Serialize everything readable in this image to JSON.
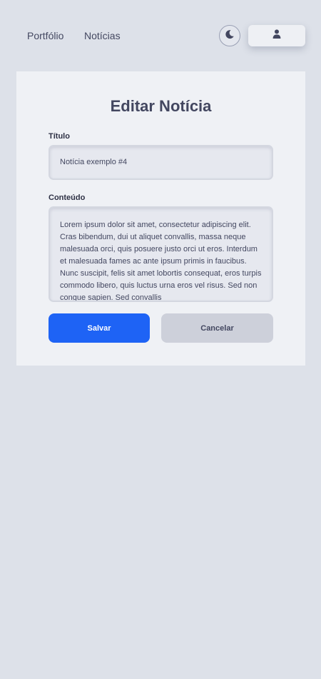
{
  "nav": {
    "links": [
      {
        "label": "Portfólio"
      },
      {
        "label": "Notícias"
      }
    ],
    "theme_toggle_icon": "moon-icon",
    "user_icon": "user-icon"
  },
  "form": {
    "title": "Editar Notícia",
    "titulo_label": "Título",
    "titulo_value": "Notícia exemplo #4",
    "conteudo_label": "Conteúdo",
    "conteudo_value": " Lorem ipsum dolor sit amet, consectetur adipiscing elit. Cras bibendum, dui ut aliquet convallis, massa neque malesuada orci, quis posuere justo orci ut eros. Interdum et malesuada fames ac ante ipsum primis in faucibus. Nunc suscipit, felis sit amet lobortis consequat, eros turpis commodo libero, quis luctus urna eros vel risus. Sed non congue sapien. Sed convallis",
    "save_label": "Salvar",
    "cancel_label": "Cancelar"
  },
  "colors": {
    "background": "#dde1e9",
    "card": "#eff1f5",
    "primary": "#1e63f5",
    "secondary_button": "#cdd0da",
    "text": "#434760"
  }
}
